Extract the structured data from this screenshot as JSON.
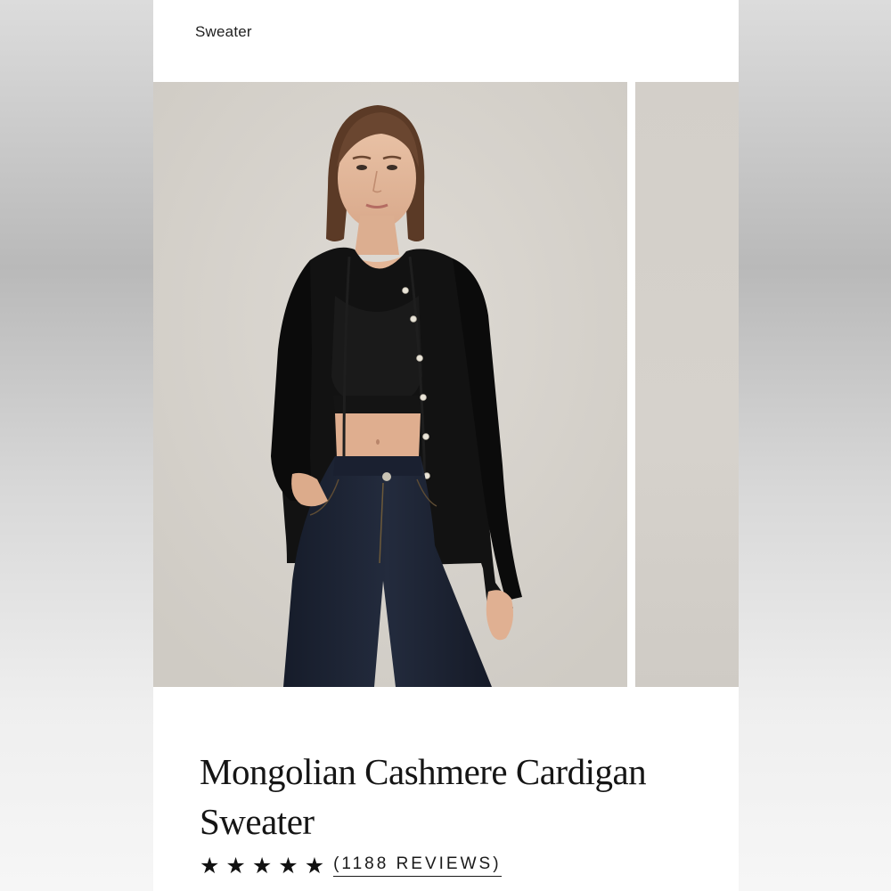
{
  "breadcrumb": {
    "label": "Sweater"
  },
  "gallery": {
    "main_image_alt": "Model wearing black cardigan sweater with dark jeans",
    "next_image_alt": "Next product image",
    "colors": {
      "backdrop": "#d7d3cd",
      "garment": "#111111",
      "denim": "#1d2333"
    }
  },
  "product": {
    "title": "Mongolian Cashmere Cardigan Sweater"
  },
  "rating": {
    "stars": 5,
    "star_glyphs": [
      "★",
      "★",
      "★",
      "★",
      "★"
    ],
    "reviews_label": "(1188 REVIEWS)"
  }
}
